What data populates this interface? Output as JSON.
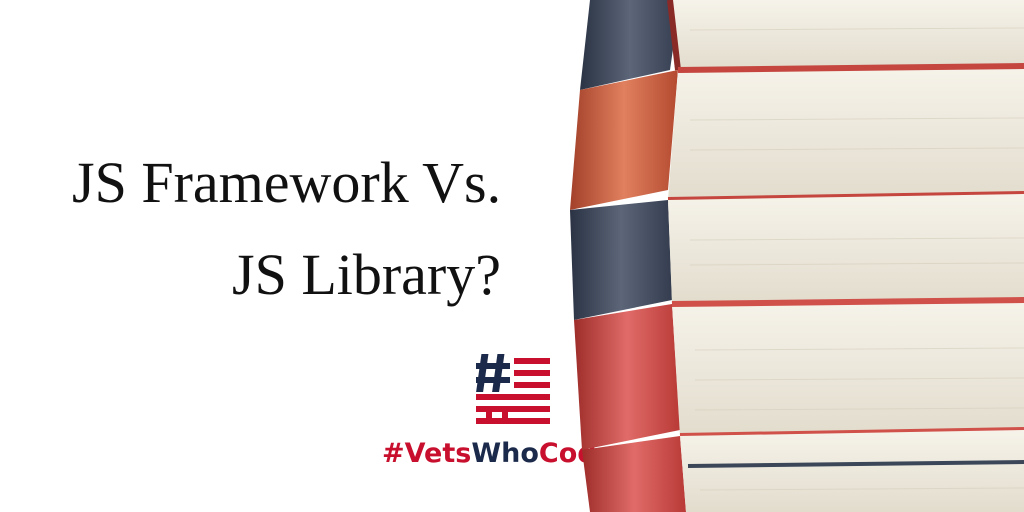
{
  "headline": {
    "line1": "JS Framework Vs.",
    "line2": "JS Library?"
  },
  "brand": {
    "prefix": "#Vets",
    "middle": "Who",
    "suffix": "Code"
  },
  "colors": {
    "brand_red": "#c8102e",
    "brand_navy": "#1b2a4a",
    "text": "#111111"
  },
  "icons": [
    "vetswhocode-flag-hash-icon",
    "book-stack-image"
  ]
}
